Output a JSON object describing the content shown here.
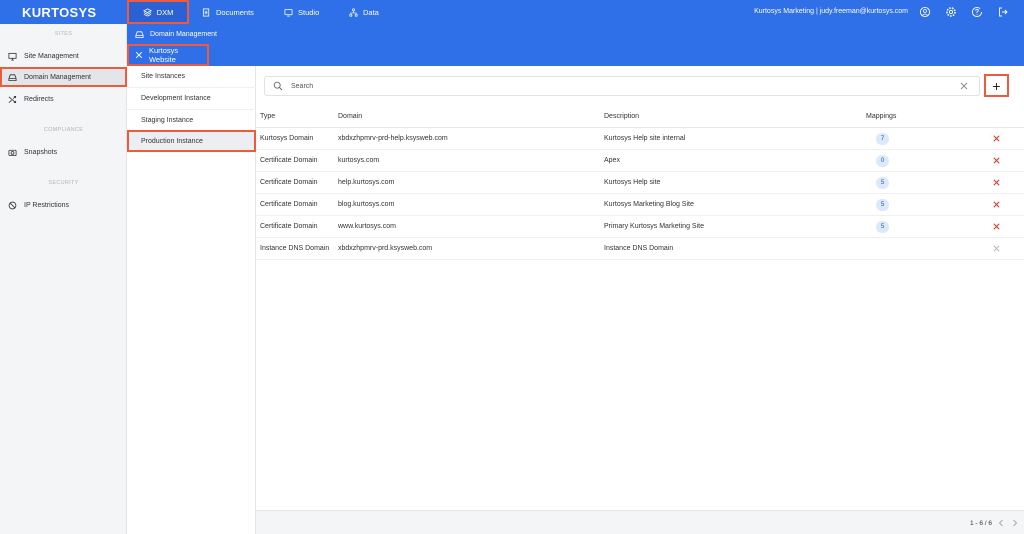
{
  "brand": "KURTOSYS",
  "top_nav": [
    {
      "label": "DXM",
      "icon": "layers-icon"
    },
    {
      "label": "Documents",
      "icon": "documents-icon"
    },
    {
      "label": "Studio",
      "icon": "studio-icon"
    },
    {
      "label": "Data",
      "icon": "data-icon"
    }
  ],
  "user": {
    "text": "Kurtosys Marketing  |  judy.freeman@kurtosys.com"
  },
  "top_icons": [
    "account-icon",
    "settings-icon",
    "help-icon",
    "logout-icon"
  ],
  "sidebar": {
    "sections": {
      "sites": "SITES",
      "compliance": "COMPLIANCE",
      "security": "SECURITY"
    },
    "items": [
      {
        "label": "Site Management",
        "icon": "monitor-icon"
      },
      {
        "label": "Domain Management",
        "icon": "drive-icon"
      },
      {
        "label": "Redirects",
        "icon": "shuffle-icon"
      },
      {
        "label": "Snapshots",
        "icon": "camera-icon"
      },
      {
        "label": "IP Restrictions",
        "icon": "block-icon"
      }
    ]
  },
  "breadcrumb": {
    "label": "Domain Management"
  },
  "title": {
    "label": "Kurtosys Website"
  },
  "subnav": {
    "items": [
      {
        "label": "Site Instances"
      },
      {
        "label": "Development Instance"
      },
      {
        "label": "Staging Instance"
      },
      {
        "label": "Production Instance"
      }
    ]
  },
  "search": {
    "placeholder": "Search",
    "value": ""
  },
  "add_label": "+",
  "table": {
    "headers": {
      "type": "Type",
      "domain": "Domain",
      "description": "Description",
      "mappings": "Mappings"
    },
    "rows": [
      {
        "type": "Kurtosys Domain",
        "domain": "xbdxzhpmrv-prd-help.ksysweb.com",
        "description": "Kurtosys Help site internal",
        "mappings": "7",
        "deletable": true
      },
      {
        "type": "Certificate Domain",
        "domain": "kurtosys.com",
        "description": "Apex",
        "mappings": "0",
        "deletable": true
      },
      {
        "type": "Certificate Domain",
        "domain": "help.kurtosys.com",
        "description": "Kurtosys Help site",
        "mappings": "5",
        "deletable": true
      },
      {
        "type": "Certificate Domain",
        "domain": "blog.kurtosys.com",
        "description": "Kurtosys Marketing Blog Site",
        "mappings": "5",
        "deletable": true
      },
      {
        "type": "Certificate Domain",
        "domain": "www.kurtosys.com",
        "description": "Primary Kurtosys Marketing Site",
        "mappings": "5",
        "deletable": true
      },
      {
        "type": "Instance DNS Domain",
        "domain": "xbdxzhpmrv-prd.ksysweb.com",
        "description": "Instance DNS Domain",
        "mappings": "",
        "deletable": false
      }
    ]
  },
  "pagination": {
    "text": "1 - 6 / 6"
  },
  "colors": {
    "primary": "#2f6fe8",
    "highlight": "#ee5a3c",
    "delete": "#e0342a",
    "delete_disabled": "#b8bcc2"
  }
}
